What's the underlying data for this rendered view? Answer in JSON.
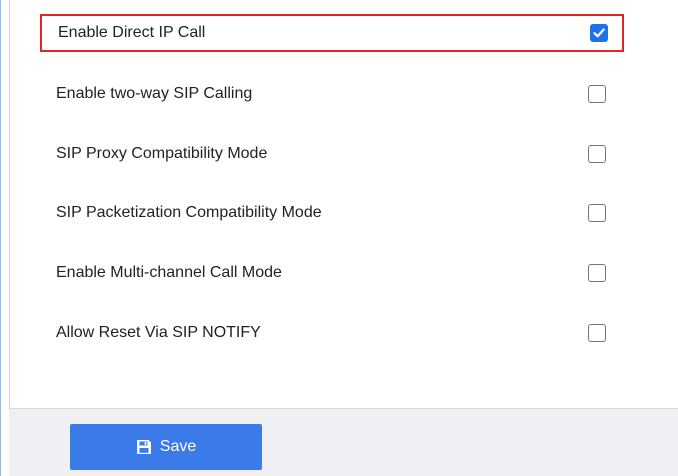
{
  "settings": [
    {
      "label": "Enable Direct IP Call",
      "checked": true,
      "highlighted": true
    },
    {
      "label": "Enable two-way SIP Calling",
      "checked": false,
      "highlighted": false
    },
    {
      "label": "SIP Proxy Compatibility Mode",
      "checked": false,
      "highlighted": false
    },
    {
      "label": "SIP Packetization Compatibility Mode",
      "checked": false,
      "highlighted": false
    },
    {
      "label": "Enable Multi-channel Call Mode",
      "checked": false,
      "highlighted": false
    },
    {
      "label": "Allow Reset Via SIP NOTIFY",
      "checked": false,
      "highlighted": false
    }
  ],
  "footer": {
    "save_label": "Save",
    "save_icon": "floppy-disk-icon"
  },
  "colors": {
    "accent": "#3b7be8",
    "checkbox_checked": "#1a73e8",
    "highlight_border": "#e0262b",
    "footer_bg": "#eef0f3"
  }
}
